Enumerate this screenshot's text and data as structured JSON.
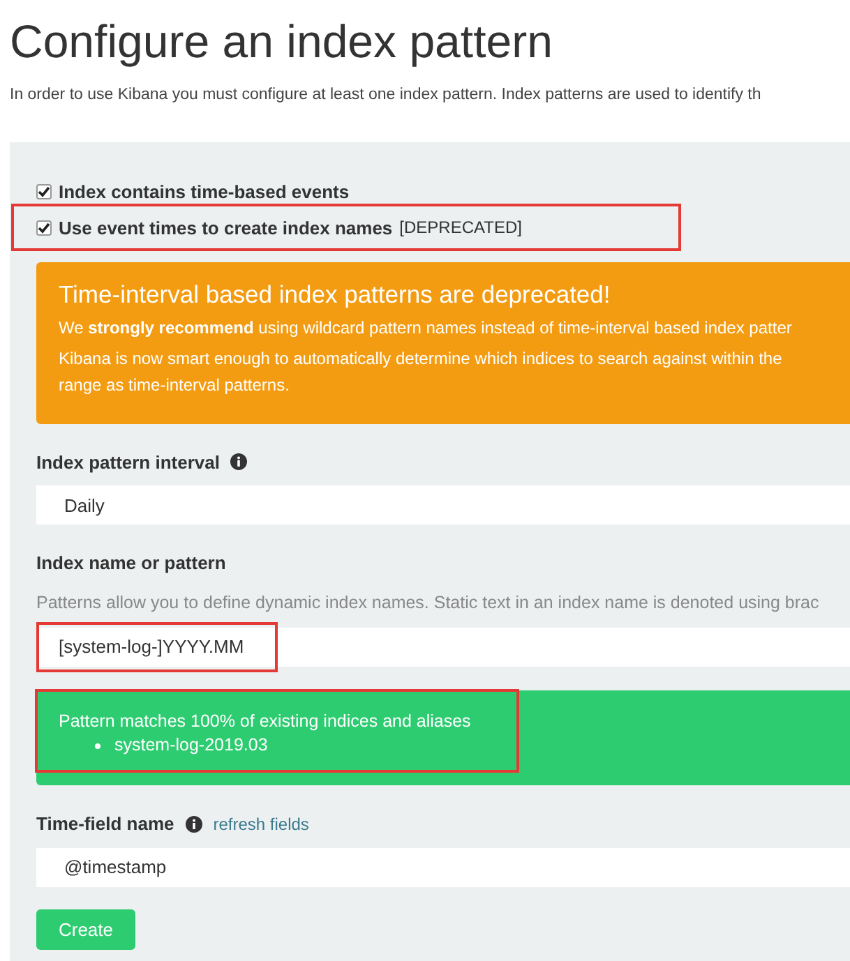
{
  "title": "Configure an index pattern",
  "intro": "In order to use Kibana you must configure at least one index pattern. Index patterns are used to identify th",
  "options": [
    {
      "label": "Index contains time-based events",
      "checked": true,
      "highlighted": false
    },
    {
      "label": "Use event times to create index names",
      "note": "[DEPRECATED]",
      "checked": true,
      "highlighted": true
    }
  ],
  "warning": {
    "heading": "Time-interval based index patterns are deprecated!",
    "lines": [
      "We **strongly recommend** using wildcard pattern names instead of time-interval based index patter",
      "Kibana is now smart enough to automatically determine which indices to search against within the",
      "range as time-interval patterns."
    ]
  },
  "interval": {
    "label": "Index pattern interval",
    "value": "Daily"
  },
  "pattern": {
    "label": "Index name or pattern",
    "help": "Patterns allow you to define dynamic index names. Static text in an index name is denoted using brac",
    "value": "[system-log-]YYYY.MM",
    "highlighted": true
  },
  "match": {
    "message": "Pattern matches 100% of existing indices and aliases",
    "items": [
      "system-log-2019.03"
    ],
    "highlighted": true
  },
  "time_field": {
    "label": "Time-field name",
    "link": "refresh fields",
    "value": "@timestamp"
  },
  "create_button": "Create"
}
